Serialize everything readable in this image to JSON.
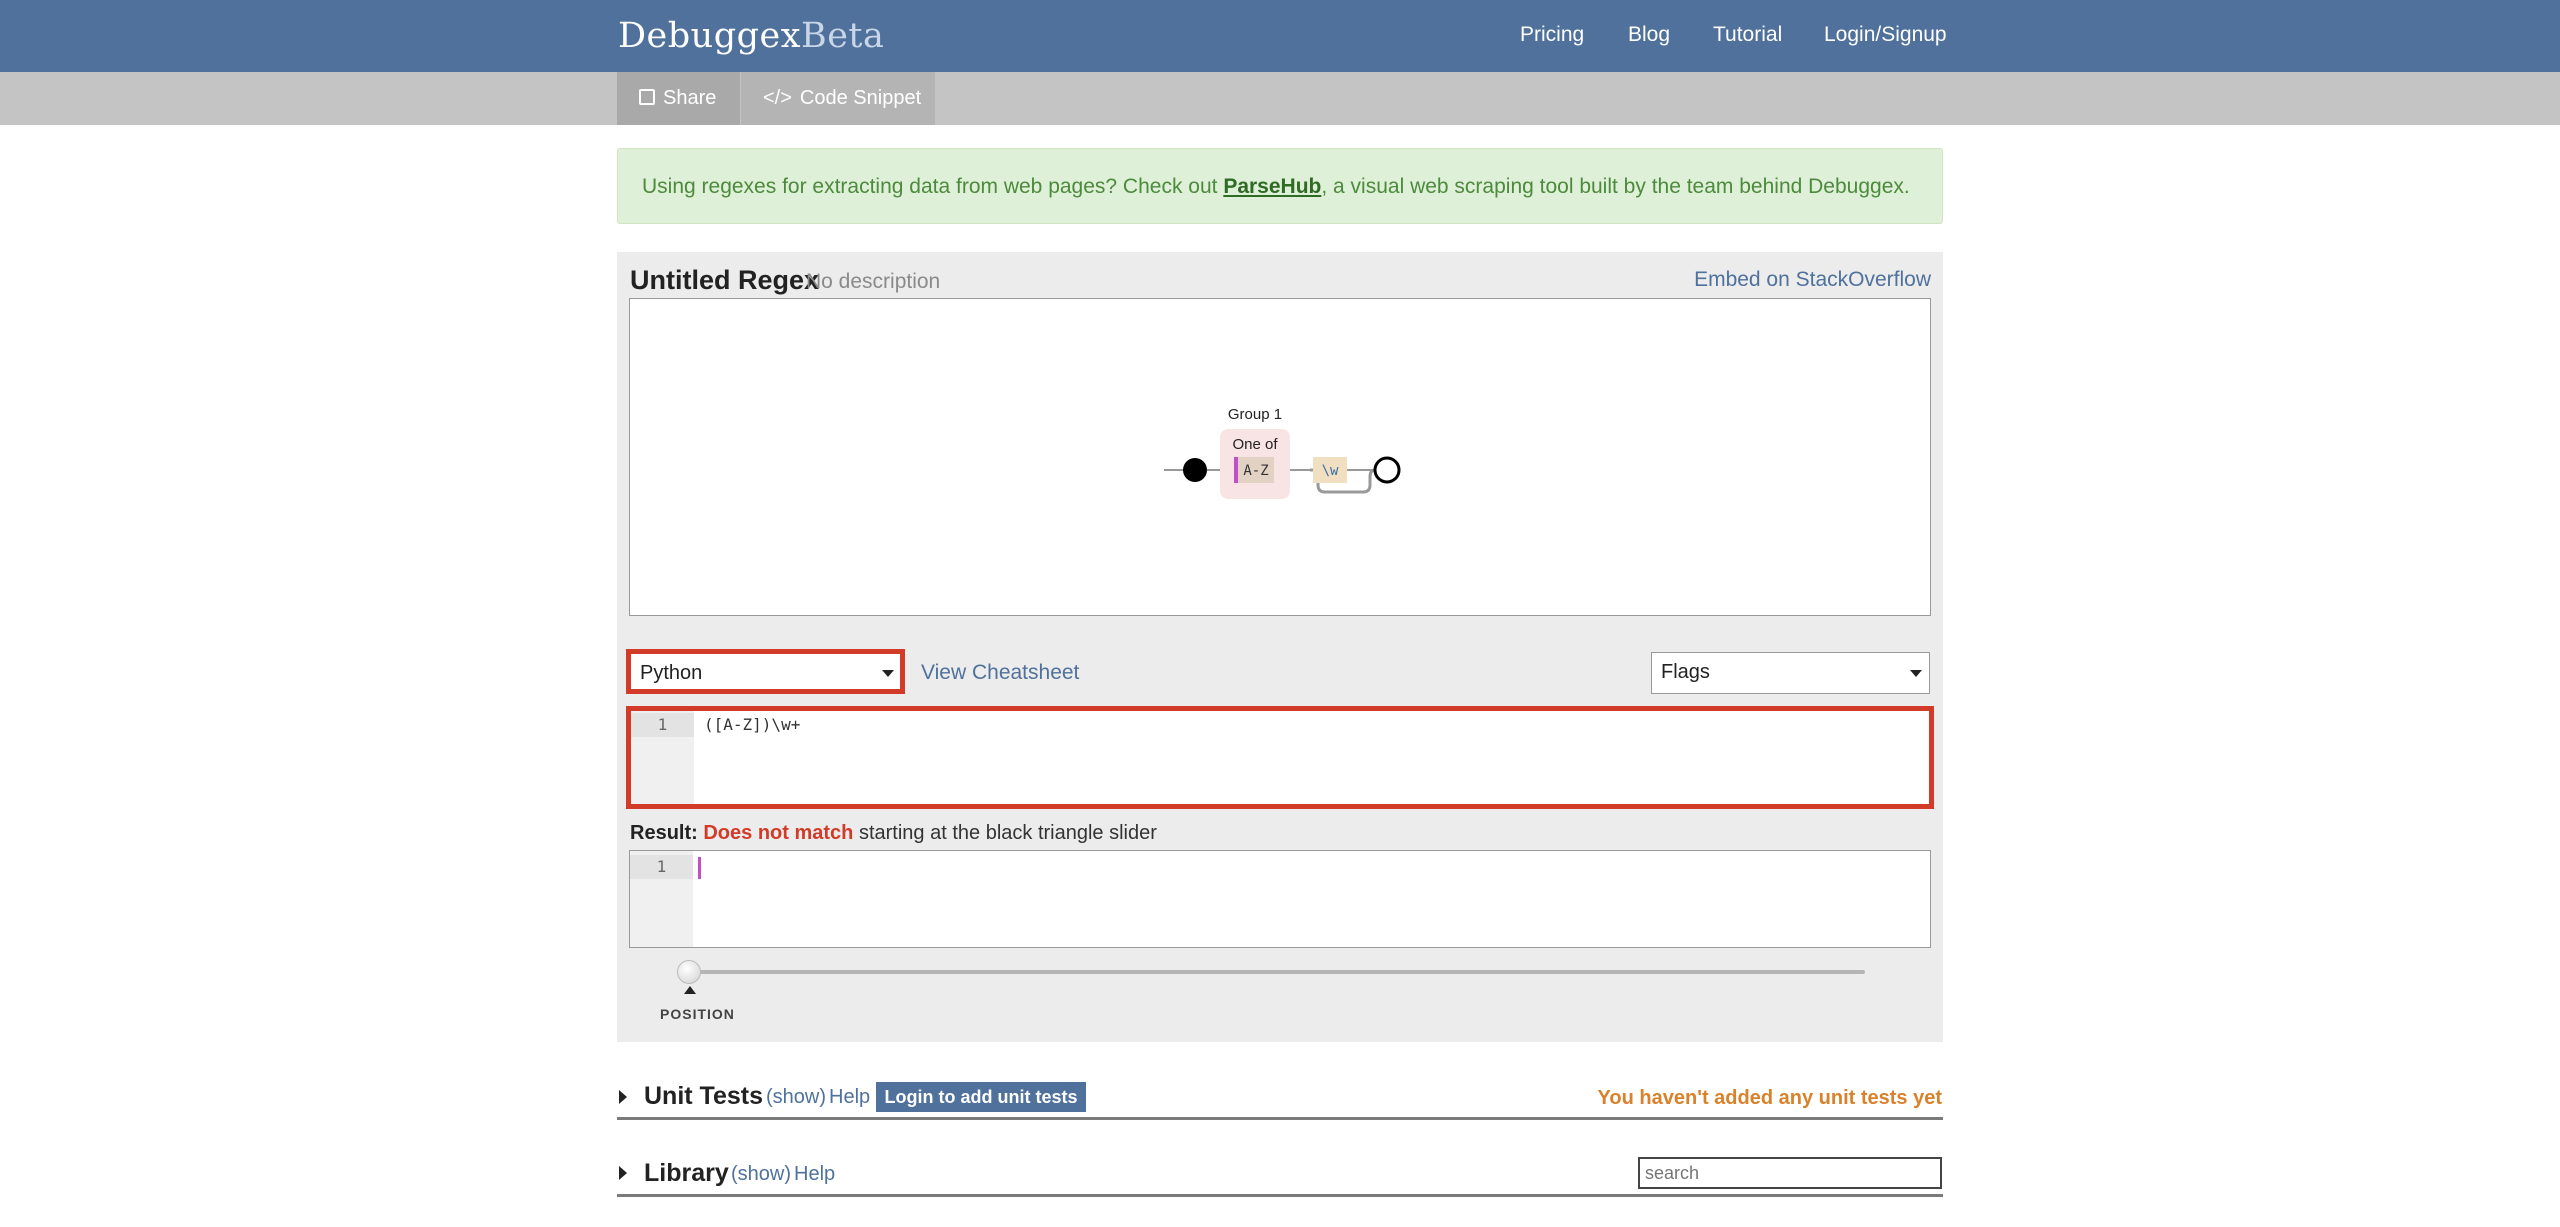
{
  "brand": {
    "name": "Debuggex",
    "suffix": "Beta"
  },
  "nav": [
    "Pricing",
    "Blog",
    "Tutorial",
    "Login/Signup"
  ],
  "toolbar": {
    "share_label": "Share",
    "snippet_label": "Code Snippet"
  },
  "notice": {
    "before": "Using regexes for extracting data from web pages? Check out ",
    "link": "ParseHub",
    "after": ", a visual web scraping tool built by the team behind Debuggex."
  },
  "regex": {
    "title": "Untitled Regex",
    "description": "No description",
    "embed_label": "Embed on StackOverflow",
    "diagram": {
      "group_label": "Group 1",
      "one_of_label": "One of",
      "range_label": "A-Z",
      "class_label": "\\w"
    },
    "language": "Python",
    "cheatsheet_label": "View Cheatsheet",
    "flags_label": "Flags",
    "line_number": "1",
    "pattern": "([A-Z])\\w+"
  },
  "result": {
    "label": "Result:",
    "status": "Does not match",
    "suffix": "starting at the black triangle slider"
  },
  "test": {
    "line_number": "1"
  },
  "slider": {
    "label": "POSITION",
    "position": 0
  },
  "unit_tests": {
    "title": "Unit Tests",
    "show_label": "(show)",
    "help_label": "Help",
    "login_button": "Login to add unit tests",
    "warning": "You haven't added any unit tests yet"
  },
  "library": {
    "title": "Library",
    "show_label": "(show)",
    "help_label": "Help",
    "search_placeholder": "search"
  },
  "colors": {
    "header": "#4f719c",
    "highlight_border": "#d23b27",
    "no_match": "#d23b27",
    "warning": "#d9822b",
    "notice_bg": "#dff0d8"
  }
}
